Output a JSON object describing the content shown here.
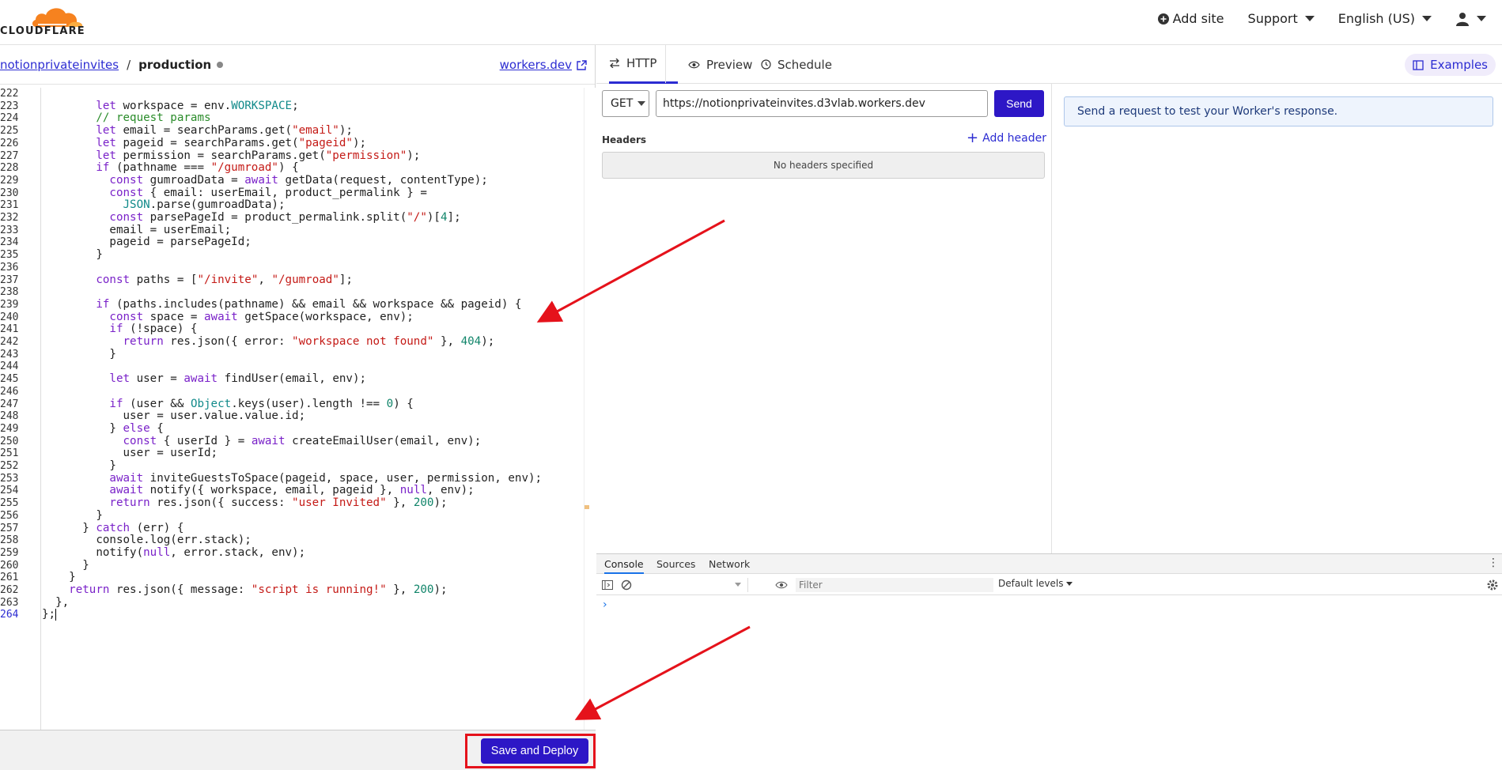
{
  "topbar": {
    "logo_text": "CLOUDFLARE",
    "add_site": "Add site",
    "support": "Support",
    "language": "English (US)"
  },
  "editor": {
    "back_link": "notionprivateinvites",
    "separator": "/",
    "environment": "production",
    "workers_link": "workers.dev",
    "save_deploy": "Save and Deploy"
  },
  "code": {
    "first_line": 222,
    "active_line": 264,
    "lines": [
      "",
      "        let workspace = env.WORKSPACE;",
      "        // request params",
      "        let email = searchParams.get(\"email\");",
      "        let pageid = searchParams.get(\"pageid\");",
      "        let permission = searchParams.get(\"permission\");",
      "        if (pathname === \"/gumroad\") {",
      "          const gumroadData = await getData(request, contentType);",
      "          const { email: userEmail, product_permalink } =",
      "            JSON.parse(gumroadData);",
      "          const parsePageId = product_permalink.split(\"/\")[4];",
      "          email = userEmail;",
      "          pageid = parsePageId;",
      "        }",
      "",
      "        const paths = [\"/invite\", \"/gumroad\"];",
      "",
      "        if (paths.includes(pathname) && email && workspace && pageid) {",
      "          const space = await getSpace(workspace, env);",
      "          if (!space) {",
      "            return res.json({ error: \"workspace not found\" }, 404);",
      "          }",
      "",
      "          let user = await findUser(email, env);",
      "",
      "          if (user && Object.keys(user).length !== 0) {",
      "            user = user.value.value.id;",
      "          } else {",
      "            const { userId } = await createEmailUser(email, env);",
      "            user = userId;",
      "          }",
      "          await inviteGuestsToSpace(pageid, space, user, permission, env);",
      "          await notify({ workspace, email, pageid }, null, env);",
      "          return res.json({ success: \"user Invited\" }, 200);",
      "        }",
      "      } catch (err) {",
      "        console.log(err.stack);",
      "        notify(null, error.stack, env);",
      "      }",
      "    }",
      "    return res.json({ message: \"script is running!\" }, 200);",
      "  },",
      "};"
    ]
  },
  "request": {
    "tabs": [
      "HTTP",
      "Preview",
      "Schedule"
    ],
    "examples": "Examples",
    "method": "GET",
    "url": "https://notionprivateinvites.d3vlab.workers.dev",
    "send": "Send",
    "headers_label": "Headers",
    "add_header": "Add header",
    "no_headers": "No headers specified"
  },
  "response": {
    "message": "Send a request to test your Worker's response."
  },
  "console": {
    "tabs": [
      "Console",
      "Sources",
      "Network"
    ],
    "filter_placeholder": "Filter",
    "levels": "Default levels",
    "prompt": "›"
  },
  "colors": {
    "accent": "#2d17c6",
    "link": "#2c2cd2",
    "highlight_box": "#e5121b",
    "cloud_orange": "#f6821f"
  }
}
